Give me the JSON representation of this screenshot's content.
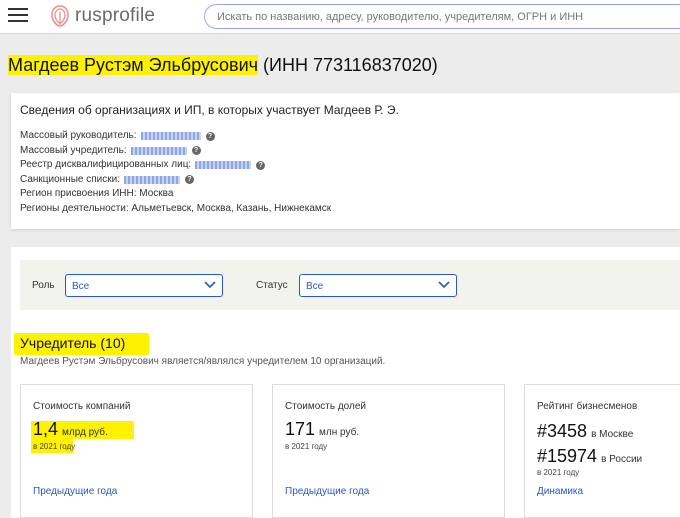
{
  "header": {
    "logo_text": "rusprofile",
    "search_placeholder": "Искать по названию, адресу, руководителю, учредителям, ОГРН и ИНН"
  },
  "page": {
    "name": "Магдеев Рустэм Эльбрусович",
    "inn_text": "(ИНН 773116837020)"
  },
  "info": {
    "heading": "Сведения об организациях и ИП, в которых участвует Магдеев Р. Э.",
    "rows": [
      {
        "label": "Массовый руководитель:"
      },
      {
        "label": "Массовый учредитель:"
      },
      {
        "label": "Реестр дисквалифицированных лиц:"
      },
      {
        "label": "Санкционные списки:"
      }
    ],
    "region_inn": "Регион присвоения ИНН: Москва",
    "regions_activity": "Регионы деятельности: Альметьевск, Москва, Казань, Нижнекамск"
  },
  "filters": {
    "role_label": "Роль",
    "role_value": "Все",
    "status_label": "Статус",
    "status_value": "Все"
  },
  "founder": {
    "title": "Учредитель (10)",
    "subtitle": "Магдеев Рустэм Эльбрусович является/являлся учредителем 10 организаций."
  },
  "cards": [
    {
      "label": "Стоимость компаний",
      "value": "1,4",
      "unit": "млрд руб.",
      "year": "в 2021 году",
      "link": "Предыдущие года"
    },
    {
      "label": "Стоимость долей",
      "value": "171",
      "unit": "млн руб.",
      "year": "в 2021 году",
      "link": "Предыдущие года"
    },
    {
      "label": "Рейтинг бизнесменов",
      "rank1": "#3458",
      "rank1_region": "в Москве",
      "rank2": "#15974",
      "rank2_region": "в России",
      "year": "в 2021 году",
      "link": "Динамика"
    }
  ],
  "colors": {
    "accent": "#2a57c8",
    "highlight": "#fff200"
  }
}
